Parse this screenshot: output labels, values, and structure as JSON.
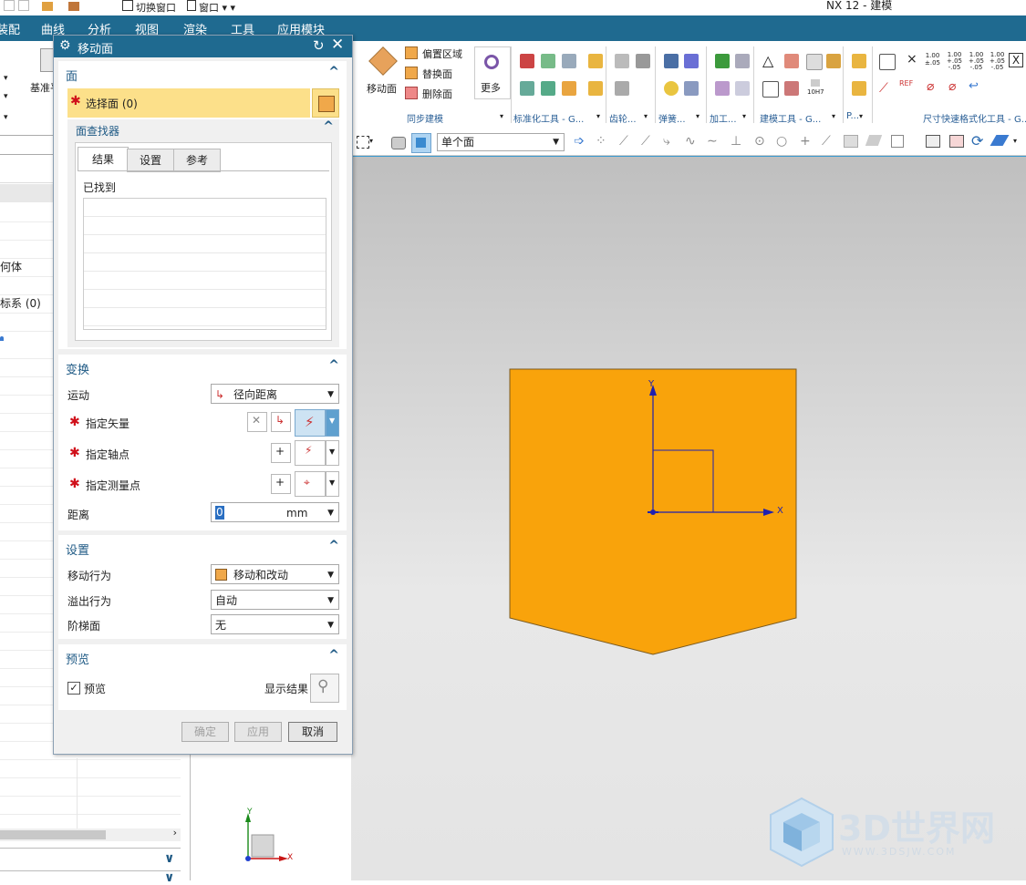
{
  "titlebar": {
    "switch_window": "切换窗口",
    "window_menu": "窗口",
    "app_title": "NX 12 - 建模"
  },
  "menubar": {
    "items": [
      "装配",
      "曲线",
      "分析",
      "视图",
      "渲染",
      "工具",
      "应用模块"
    ]
  },
  "ribbon": {
    "datum_label": "基准平",
    "move_face": "移动面",
    "offset_region": "偏置区域",
    "replace_face": "替换面",
    "delete_face": "删除面",
    "more": "更多",
    "group_sync": "同步建模",
    "group_std_tools": "标准化工具 - G...",
    "group_gear": "齿轮...",
    "group_spring": "弹簧...",
    "group_machining": "加工...",
    "group_modeling_tools": "建模工具 - G...",
    "group_p": "P...",
    "group_dim_format": "尺寸快速格式化工具 - G...",
    "dim_values": [
      "1.00\n±.05",
      "1.00\n+.05\n-.05",
      "1.00\n+.05\n-.05",
      "1.00\n+.05\n-.05"
    ],
    "fit_label": "10H7",
    "ref_label": "REF"
  },
  "select_toolbar": {
    "face_filter": "单个面"
  },
  "left_nav": {
    "rows": [
      "",
      "",
      "",
      "",
      "何体",
      "",
      "标系 (0)",
      "",
      "",
      ""
    ],
    "expand_glyph": "∨"
  },
  "dialog": {
    "title": "移动面",
    "section_face": "面",
    "select_face": "选择面 (0)",
    "face_finder": "面查找器",
    "tabs": [
      "结果",
      "设置",
      "参考"
    ],
    "found_label": "已找到",
    "section_transform": "变换",
    "motion_label": "运动",
    "motion_value": "径向距离",
    "specify_vector": "指定矢量",
    "specify_axis_point": "指定轴点",
    "specify_measure_point": "指定测量点",
    "distance_label": "距离",
    "distance_value": "0",
    "distance_unit": "mm",
    "section_settings": "设置",
    "move_behavior_label": "移动行为",
    "move_behavior_value": "移动和改动",
    "overflow_label": "溢出行为",
    "overflow_value": "自动",
    "step_face_label": "阶梯面",
    "step_face_value": "无",
    "section_preview": "预览",
    "preview_checkbox": "预览",
    "show_result": "显示结果",
    "ok": "确定",
    "apply": "应用",
    "cancel": "取消"
  },
  "viewport": {
    "axis_x": "X",
    "axis_y": "Y",
    "part_color": "#f9a30b",
    "watermark_brand": "3D世界网",
    "watermark_url": "WWW.3DSJW.COM"
  },
  "colors": {
    "menubar": "#1f6a90",
    "select_highlight": "#fce08a",
    "required_star": "#d0101a",
    "section_title": "#1f5a85"
  }
}
